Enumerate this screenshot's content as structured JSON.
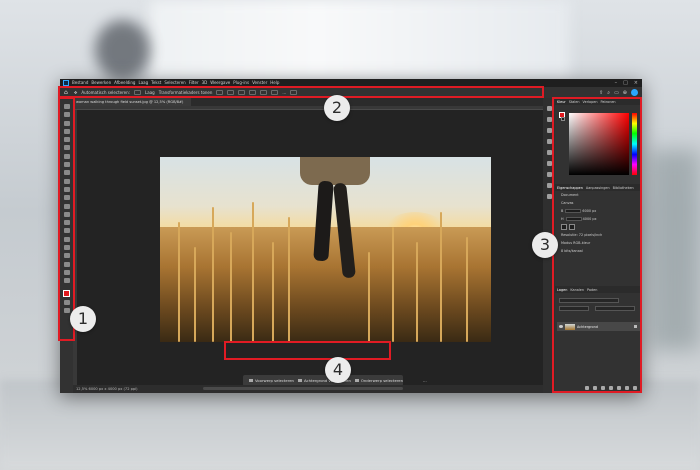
{
  "app": {
    "menu": [
      "Ps",
      "Bestand",
      "Bewerken",
      "Afbeelding",
      "Laag",
      "Tekst",
      "Selecteren",
      "Filter",
      "3D",
      "Weergave",
      "Plug-ins",
      "Venster",
      "Help"
    ],
    "options_bar": {
      "items": [
        "Automatisch selecteren:",
        "Laag",
        "Transformatiekaders tonen"
      ],
      "more_label": "..."
    },
    "document_tab": "woman walking through field sunset.jpg @ 12,5% (RGB/8#)",
    "status": "12,5%   6000 px x 4000 px (72 ppi)",
    "contextual_taskbar": {
      "items": [
        "Voorwerp selecteren",
        "Achtergrond verwijderen",
        "Onderwerp selecteren"
      ],
      "more_label": "..."
    },
    "panels": {
      "color_tabs": [
        "Kleur",
        "Stalen",
        "Verlopen",
        "Patronen"
      ],
      "props_tabs": [
        "Eigenschappen",
        "Aanpassingen",
        "Bibliotheken"
      ],
      "props_section": "Document",
      "props_sub": "Canvas",
      "props_w_label": "B",
      "props_w_value": "6000 px",
      "props_h_label": "H",
      "props_h_value": "4000 px",
      "props_res": "Resolutie: 72 pixels/inch",
      "props_mode_label": "Modus",
      "props_mode_value": "RGB-kleur",
      "props_depth": "8 bits/kanaal",
      "layers_tabs": [
        "Lagen",
        "Kanalen",
        "Paden"
      ],
      "layer_name": "Achtergrond"
    },
    "colors": {
      "highlight": "#e01b24",
      "foreground": "#e0191e",
      "accent": "#31a8ff"
    }
  },
  "callouts": [
    {
      "label": "1"
    },
    {
      "label": "2"
    },
    {
      "label": "3"
    },
    {
      "label": "4"
    }
  ]
}
